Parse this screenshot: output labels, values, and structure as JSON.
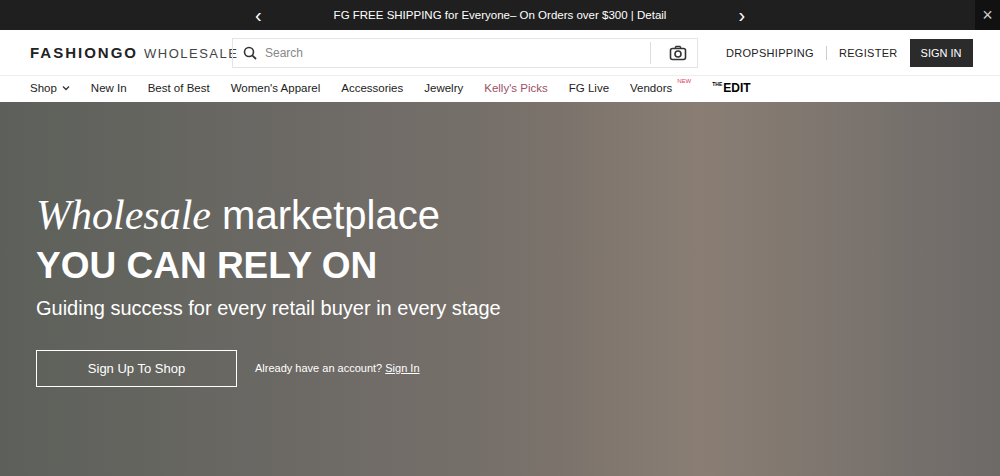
{
  "announcement": {
    "prev": "‹",
    "text": "FG FREE SHIPPING for Everyone– On Orders over $300 | Detail",
    "next": "›",
    "close": "×"
  },
  "logo": {
    "brand": "FASHIONGO",
    "sub": "WHOLESALE"
  },
  "search": {
    "placeholder": "Search"
  },
  "header_links": [
    "DROPSHIPPING",
    "REGISTER"
  ],
  "sign_in": "SIGN IN",
  "nav": [
    {
      "label": "Shop",
      "dropdown": true,
      "color": "#222222"
    },
    {
      "label": "New In",
      "color": "#222222"
    },
    {
      "label": "Best of Best",
      "color": "#222222"
    },
    {
      "label": "Women's Apparel",
      "color": "#222222"
    },
    {
      "label": "Accessories",
      "color": "#222222"
    },
    {
      "label": "Jewelry",
      "color": "#222222"
    },
    {
      "label": "Kelly's Picks",
      "color": "#9c4f68"
    },
    {
      "label": "FG Live",
      "color": "#222222"
    },
    {
      "label": "Vendors",
      "badge": "NEW",
      "color": "#222222"
    },
    {
      "label": "EDIT",
      "prefix": "THE",
      "color": "#000000"
    }
  ],
  "hero": {
    "title_italic": "Wholesale",
    "title_rest": "marketplace",
    "headline": "YOU CAN RELY ON",
    "subhead": "Guiding success for every retail buyer in every stage",
    "cta": "Sign Up To Shop",
    "signin_prompt": "Already have an account?",
    "signin_link": "Sign In"
  }
}
